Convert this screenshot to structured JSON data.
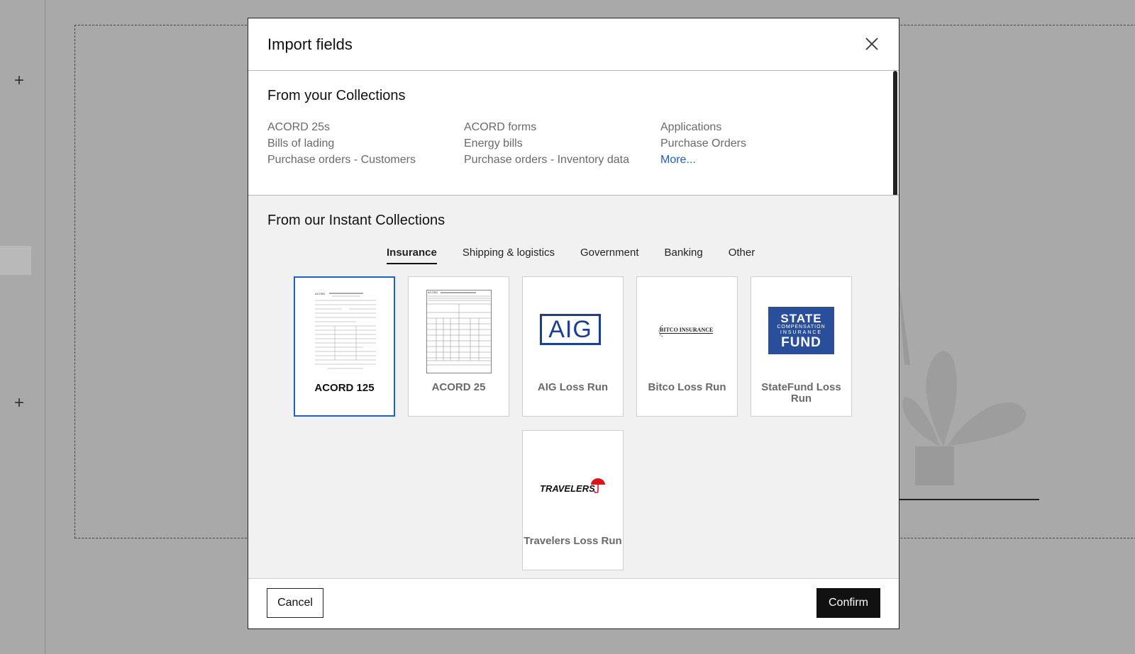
{
  "background": {
    "plus_glyph": "+"
  },
  "modal": {
    "title": "Import fields",
    "close_icon": "close-icon",
    "your_collections": {
      "title": "From your Collections",
      "items": [
        "ACORD 25s",
        "ACORD forms",
        "Applications",
        "Bills of lading",
        "Energy bills",
        "Purchase Orders",
        "Purchase orders - Customers",
        "Purchase orders - Inventory data",
        "More..."
      ]
    },
    "instant_collections": {
      "title": "From our Instant Collections",
      "tabs": [
        "Insurance",
        "Shipping & logistics",
        "Government",
        "Banking",
        "Other"
      ],
      "active_tab": "Insurance",
      "cards": [
        {
          "label": "ACORD 125",
          "selected": true,
          "image": "acord-125-form-thumbnail"
        },
        {
          "label": "ACORD 25",
          "selected": false,
          "image": "acord-25-form-thumbnail"
        },
        {
          "label": "AIG Loss Run",
          "selected": false,
          "image": "aig-logo",
          "logo_text": "AIG"
        },
        {
          "label": "Bitco Loss Run",
          "selected": false,
          "image": "bitco-logo",
          "logo_text": "BITCO INSURANCE"
        },
        {
          "label": "StateFund Loss Run",
          "selected": false,
          "image": "statefund-logo",
          "logo_text": [
            "STATE",
            "COMPENSATION",
            "INSURANCE",
            "FUND"
          ]
        },
        {
          "label": "Travelers Loss Run",
          "selected": false,
          "image": "travelers-logo",
          "logo_text": "TRAVELERS"
        }
      ]
    },
    "footer": {
      "cancel_label": "Cancel",
      "confirm_label": "Confirm"
    }
  },
  "colors": {
    "selected_border": "#1f5fc7",
    "link": "#1f5fc7",
    "confirm_bg": "#111111",
    "aig_blue": "#1c3f94",
    "statefund_blue": "#2a4f9a",
    "travelers_red": "#e0131a"
  }
}
